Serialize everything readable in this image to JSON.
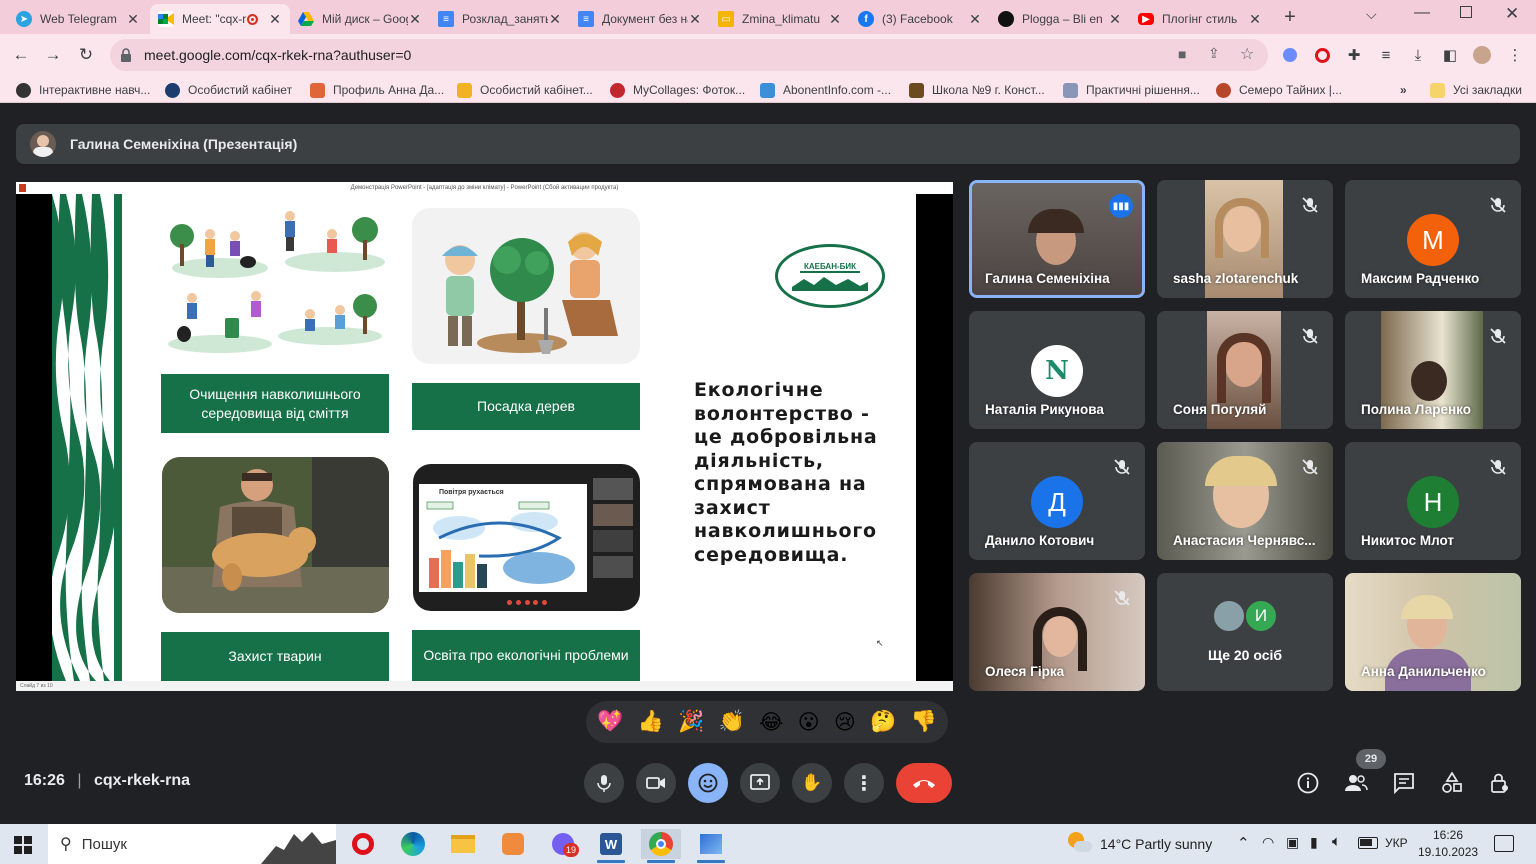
{
  "browser": {
    "tabs": [
      {
        "label": "Web Telegram",
        "icon": "telegram-icon",
        "color": "#2aa3e0"
      },
      {
        "label": "Meet: \"cqx-rkek-rna\"",
        "icon": "meet-icon",
        "color": "#00897b",
        "active": true
      },
      {
        "label": "Мій диск – Google Диск",
        "icon": "google-drive-icon",
        "color": "#1fa463"
      },
      {
        "label": "Розклад_занять",
        "icon": "google-docs-icon",
        "color": "#4285f4"
      },
      {
        "label": "Документ без назви",
        "icon": "google-docs-icon",
        "color": "#4285f4"
      },
      {
        "label": "Zmina_klimatu",
        "icon": "google-slides-icon",
        "color": "#f4b400"
      },
      {
        "label": "(3) Facebook",
        "icon": "facebook-icon",
        "color": "#1877f2"
      },
      {
        "label": "Plogga – Bli en",
        "icon": "plogga-icon",
        "color": "#111111"
      },
      {
        "label": "Плогінг стиль",
        "icon": "youtube-icon",
        "color": "#ff0000"
      }
    ],
    "new_tab": "+",
    "url": "meet.google.com/cqx-rkek-rna?authuser=0",
    "bookmarks": [
      {
        "label": "Інтерактивне навч...",
        "color": "#333333"
      },
      {
        "label": "Особистий кабінет",
        "color": "#1c3d6e"
      },
      {
        "label": "Профиль Анна Да...",
        "color": "#e0663a"
      },
      {
        "label": "Особистий кабінет...",
        "color": "#f0b323"
      },
      {
        "label": "MyCollages: Фоток...",
        "color": "#c1272d"
      },
      {
        "label": "AbonentInfo.com -...",
        "color": "#3b8fd8"
      },
      {
        "label": "Школа №9 г. Конст...",
        "color": "#6b4a1d"
      },
      {
        "label": "Практичні рішення...",
        "color": "#8a96b8"
      },
      {
        "label": "Семеро Тайних |...",
        "color": "#b7472a"
      }
    ],
    "bookmarks_more": "»",
    "all_bookmarks": "Усі закладки"
  },
  "meet": {
    "presenter_bar": "Галина Семеніхіна (Презентація)",
    "ppt_title": "Демонстрація PowerPoint - [адаптація до зміни клімату] - PowerPoint (Сбой активации продукта)",
    "ppt_status": "Слайд 7 из 10",
    "slide": {
      "logo_text": "КАЕБАН-БИК",
      "captions": [
        "Очищення навколишнього середовища від сміття",
        "Посадка дерев",
        "Захист тварин",
        "Освіта про екологічні проблеми"
      ],
      "inset_title": "Повітря рухається",
      "main_text": "Екологічне волонтерство - це добровільна діяльність, спрямована на захист навколишнього середовища."
    },
    "participants": [
      {
        "name": "Галина Семеніхіна",
        "type": "video",
        "speaking": true
      },
      {
        "name": "sasha zlotarenchuk",
        "type": "video",
        "muted": true
      },
      {
        "name": "Максим Радченко",
        "type": "avatar",
        "initial": "M",
        "color": "#f4610b",
        "muted": true
      },
      {
        "name": "Наталія Рикунова",
        "type": "avatar",
        "initial": "N",
        "color": "#ffffff",
        "muted": false
      },
      {
        "name": "Соня Погуляй",
        "type": "video",
        "muted": true
      },
      {
        "name": "Полина Ларенко",
        "type": "video",
        "muted": true
      },
      {
        "name": "Данило Котович",
        "type": "avatar",
        "initial": "Д",
        "color": "#1a73e8",
        "muted": true
      },
      {
        "name": "Анастасия Чернявс...",
        "type": "video",
        "muted": true
      },
      {
        "name": "Никитос Млот",
        "type": "avatar",
        "initial": "Н",
        "color": "#1e7e34",
        "muted": true
      },
      {
        "name": "Олеся Гірка",
        "type": "video",
        "muted": true
      },
      {
        "name": "Ще 20 осіб",
        "type": "more",
        "initial": "И",
        "color": "#34a853"
      },
      {
        "name": "Анна Данильченко",
        "type": "video",
        "muted": false
      }
    ],
    "reactions": [
      "💖",
      "👍",
      "🎉",
      "👏",
      "😂",
      "😮",
      "😢",
      "🤔",
      "👎"
    ],
    "time": "16:26",
    "meeting_code": "cqx-rkek-rna",
    "people_count": "29",
    "colors": {
      "end_call": "#ea4335",
      "active_ctrl": "#8ab4f8"
    }
  },
  "taskbar": {
    "search_placeholder": "Пошук",
    "weather_temp": "14°C",
    "weather_text": "Partly sunny",
    "lang": "УКР",
    "time": "16:26",
    "date": "19.10.2023",
    "viber_badge": "19"
  }
}
